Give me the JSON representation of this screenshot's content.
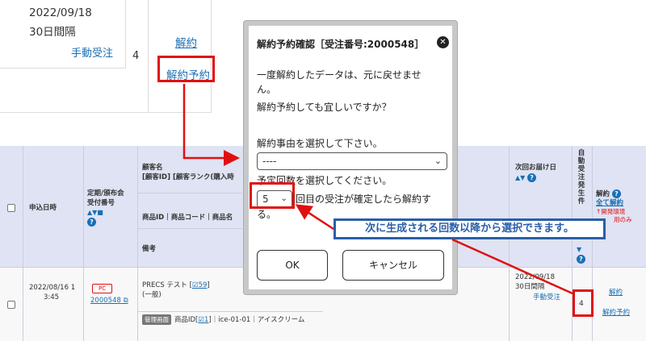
{
  "top": {
    "date": "2022/09/18",
    "cycle": "30日間隔",
    "manual": "手動受注",
    "num": "4",
    "cancel_link": "解約",
    "reserve_link": "解約予約"
  },
  "table": {
    "headers": {
      "apply_date": "申込日時",
      "subscription": "定期/頒布会",
      "order_no": "受付番号",
      "customer": "顧客名",
      "customer_sub": "[顧客ID] [顧客ランク(購入時",
      "product": "商品ID｜商品コード｜商品名",
      "notes": "備考",
      "next_delivery": "次回お届け日",
      "auto_order": "自動受注発生件",
      "cancel": "解約",
      "cancel_all": "全て解約",
      "dev_info": "↑開発環境",
      "dev_info2": "用のみ"
    },
    "row": {
      "apply_date": "2022/08/16 1",
      "apply_time": "3:45",
      "pc_badge": "PC",
      "order_no": "2000548",
      "customer_name": "PRECS テスト",
      "customer_id": "59",
      "customer_rank": "(一般)",
      "mgmt_badge": "管理画面",
      "product_prefix": "商品ID[",
      "product_id": "1",
      "product_rest": "]｜ice-01-01｜アイスクリーム",
      "next_date": "2022/09/18",
      "next_cycle": "30日間隔",
      "next_manual": "手動受注",
      "auto_count": "4",
      "cancel_link": "解約",
      "reserve_link": "解約予約"
    }
  },
  "modal": {
    "title": "解約予約確認［受注番号:2000548］",
    "msg1": "一度解約したデータは、元に戻せませ",
    "msg2": "ん。",
    "msg3": "解約予約しても宜しいですか？",
    "reason_label": "解約事由を選択して下さい。",
    "reason_value": "----",
    "count_label": "予定回数を選択してください。",
    "count_value": "5",
    "count_after1": "回目の受注が確定したら解約す",
    "count_after2": "る。",
    "ok": "OK",
    "cancel": "キャンセル"
  },
  "callout": {
    "text": "次に生成される回数以降から選択できます。"
  },
  "colors": {
    "link": "#1a6fb5",
    "highlight_red": "#e01010",
    "callout_blue": "#2a5ea8",
    "header_bg": "#dfe3f3"
  }
}
